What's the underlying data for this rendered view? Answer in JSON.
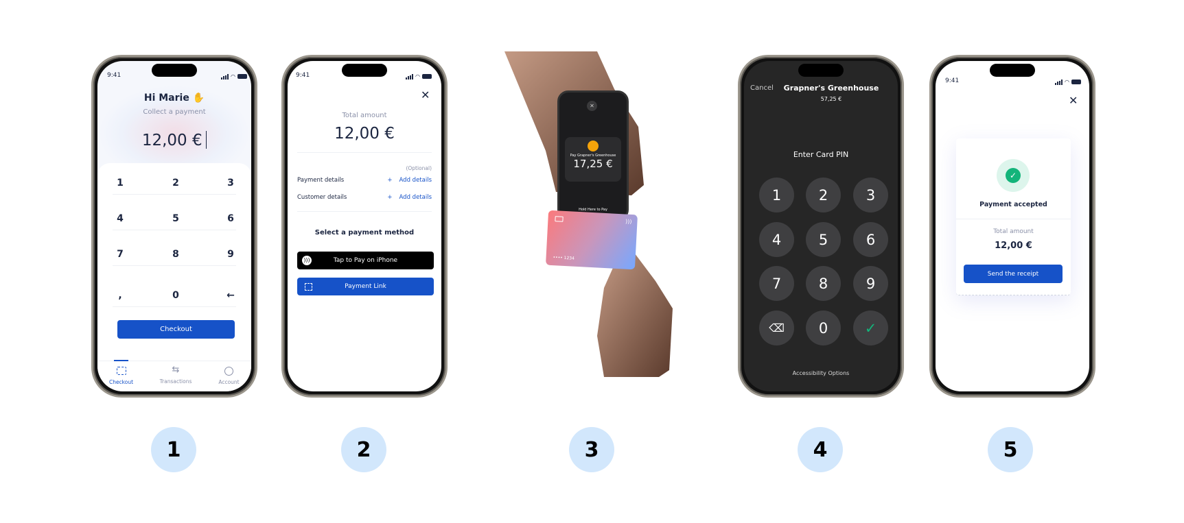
{
  "status_time": "9:41",
  "colors": {
    "primary": "#1652c8",
    "step_bg": "#d2e7fc",
    "success": "#13b47a",
    "pin_bg": "#262626"
  },
  "screen1": {
    "greeting": "Hi Marie ✋",
    "subtitle": "Collect a payment",
    "amount": "12,00 €",
    "keys": [
      "1",
      "2",
      "3",
      "4",
      "5",
      "6",
      "7",
      "8",
      "9",
      ",",
      "0",
      "←"
    ],
    "checkout": "Checkout",
    "tabs": [
      {
        "label": "Checkout",
        "icon": "card-scan-icon",
        "active": true
      },
      {
        "label": "Transactions",
        "icon": "arrows-exchange-icon"
      },
      {
        "label": "Account",
        "icon": "user-circle-icon"
      }
    ]
  },
  "screen2": {
    "total_label": "Total amount",
    "amount": "12,00 €",
    "optional": "(Optional)",
    "rows": [
      {
        "label": "Payment details",
        "action": "Add details"
      },
      {
        "label": "Customer details",
        "action": "Add details"
      }
    ],
    "plus": "+",
    "method_title": "Select a payment method",
    "tap_to_pay": "Tap to Pay on iPhone",
    "payment_link": "Payment Link"
  },
  "screen3": {
    "merchant": "Pay Grapner's Greenhouse",
    "amount": "17,25 €",
    "hint": "Hold Here to Pay",
    "card_number": "•••• 1234"
  },
  "screen4": {
    "cancel": "Cancel",
    "merchant": "Grapner's Greenhouse",
    "amount": "57,25 €",
    "prompt": "Enter Card PIN",
    "keys": [
      "1",
      "2",
      "3",
      "4",
      "5",
      "6",
      "7",
      "8",
      "9",
      "⌫",
      "0",
      "✓"
    ],
    "accessibility": "Accessibility Options"
  },
  "screen5": {
    "status": "Payment accepted",
    "total_label": "Total amount",
    "amount": "12,00 €",
    "button": "Send the receipt"
  },
  "steps": [
    "1",
    "2",
    "3",
    "4",
    "5"
  ]
}
